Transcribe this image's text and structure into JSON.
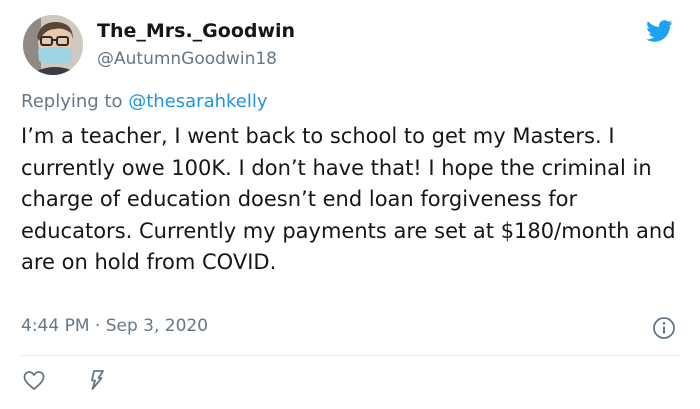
{
  "tweet": {
    "display_name": "The_Mrs._Goodwin",
    "handle": "@AutumnGoodwin18",
    "reply_prefix": "Replying to",
    "reply_to": "@thesarahkelly",
    "text": "I’m a teacher, I went back to school to get my Masters. I currently owe 100K. I don’t have that! I hope the criminal in charge of education doesn’t end loan forgiveness for educators. Currently my payments are set at $180/month and are on hold from COVID.",
    "timestamp": "4:44 PM · Sep 3, 2020"
  },
  "icons": {
    "brand": "twitter-bird-icon",
    "info": "info-icon",
    "like": "heart-icon",
    "share": "share-icon"
  },
  "colors": {
    "brand_blue": "#1da1f2",
    "link_blue": "#1b95e0",
    "secondary_text": "#657786",
    "divider": "#e1e8ed"
  }
}
